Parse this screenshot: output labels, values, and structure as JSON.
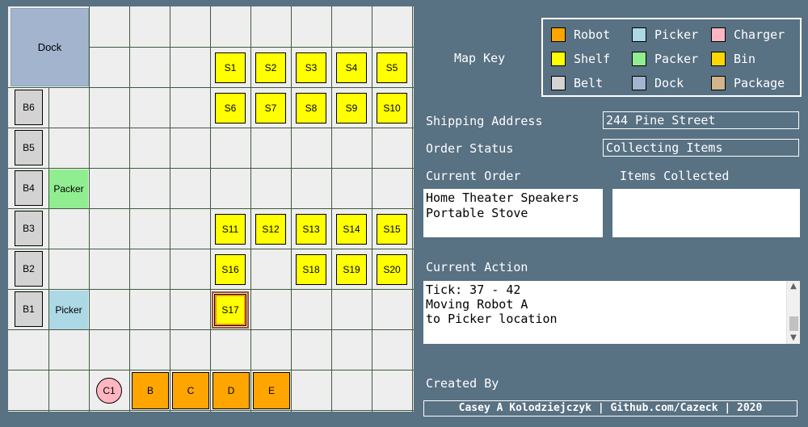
{
  "grid": {
    "dock": "Dock",
    "shelves": [
      "S1",
      "S2",
      "S3",
      "S4",
      "S5",
      "S6",
      "S7",
      "S8",
      "S9",
      "S10",
      "S11",
      "S12",
      "S13",
      "S14",
      "S15",
      "S16",
      "S18",
      "S19",
      "S20",
      "S17"
    ],
    "belts": [
      "B6",
      "B5",
      "B4",
      "B3",
      "B2",
      "B1"
    ],
    "packer": "Packer",
    "picker": "Picker",
    "charger": "C1",
    "robots": [
      "B",
      "C",
      "D",
      "E"
    ]
  },
  "map_key": {
    "title": "Map Key",
    "items": [
      {
        "label": "Robot",
        "color": "#ffa500"
      },
      {
        "label": "Picker",
        "color": "#add8e6"
      },
      {
        "label": "Charger",
        "color": "#ffb6c1"
      },
      {
        "label": "Shelf",
        "color": "#ffff00"
      },
      {
        "label": "Packer",
        "color": "#90ee90"
      },
      {
        "label": "Bin",
        "color": "#ffd700"
      },
      {
        "label": "Belt",
        "color": "#d3d3d3"
      },
      {
        "label": "Dock",
        "color": "#a3b5ce"
      },
      {
        "label": "Package",
        "color": "#d2b48c"
      }
    ]
  },
  "shipping": {
    "label": "Shipping Address",
    "value": "244 Pine Street"
  },
  "status": {
    "label": "Order Status",
    "value": "Collecting Items"
  },
  "current_order": {
    "label": "Current Order",
    "text": "Home Theater Speakers\nPortable Stove"
  },
  "items_collected": {
    "label": "Items Collected",
    "text": ""
  },
  "current_action": {
    "label": "Current Action",
    "text": "Tick: 37 - 42\nMoving Robot A\nto Picker location"
  },
  "created_by": {
    "label": "Created By",
    "text": "Casey A Kolodziejczyk | Github.com/Cazeck | 2020"
  }
}
